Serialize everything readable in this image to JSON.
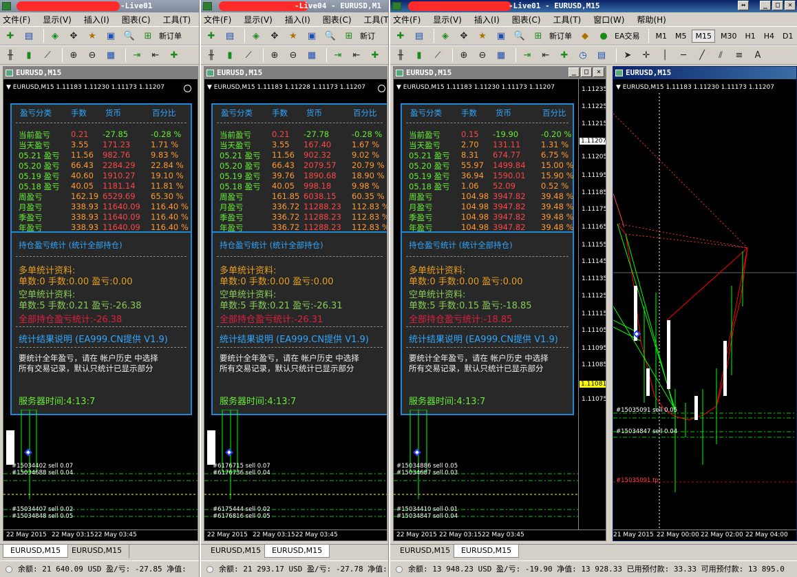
{
  "terminals": [
    {
      "title": "-Live01",
      "menus": [
        "文件(F)",
        "显示(V)",
        "插入(I)",
        "图表(C)",
        "工具(T)"
      ],
      "toolbar_text": "新订单",
      "chart_title": "EURUSD,M15",
      "chart_info": "EURUSD,M15  1.11183 1.11230 1.11173 1.11207",
      "panel": {
        "headers": [
          "盈亏分类",
          "手数",
          "货币",
          "百分比"
        ],
        "rows": [
          [
            "当前盈亏",
            "0.21",
            "-27.85",
            "-0.28 %"
          ],
          [
            "当天盈亏",
            "3.55",
            "171.23",
            "1.71 %"
          ],
          [
            "05.21 盈亏",
            "11.56",
            "982.76",
            "9.83 %"
          ],
          [
            "05.20 盈亏",
            "66.43",
            "2284.29",
            "22.84 %"
          ],
          [
            "05.19 盈亏",
            "40.60",
            "1910.27",
            "19.10 %"
          ],
          [
            "05.18 盈亏",
            "40.05",
            "1181.14",
            "11.81 %"
          ],
          [
            "周盈亏",
            "162.19",
            "6529.69",
            "65.30 %"
          ],
          [
            "月盈亏",
            "338.93",
            "11640.09",
            "116.40 %"
          ],
          [
            "季盈亏",
            "338.93",
            "11640.09",
            "116.40 %"
          ],
          [
            "年盈亏",
            "338.93",
            "11640.09",
            "116.40 %"
          ]
        ],
        "pos_title": "持仓盈亏统计  (统计全部持仓)",
        "long_title": "多单统计资料:",
        "long_line": "单数:0      手数:0.00    盈亏:0.00",
        "short_title": "空单统计资料:",
        "short_line": "单数:5      手数:0.21    盈亏:-26.38",
        "total": "全部持仓盈亏统计:-26.38",
        "note_title": "统计结果说明   (EA999.CN提供 V1.9)",
        "note1": "要统计全年盈亏，请在 帐户历史 中选择",
        "note2": "所有交易记录，默认只统计已显示部分",
        "server": "服务器时间:4:13:7"
      },
      "orders": [
        "#15034402 sell 0.07",
        "#15034688 sell 0.04",
        "#15034407 sell 0.02",
        "#15034848 sell 0.05"
      ],
      "xlabels": [
        "22 May 2015",
        "22 May 03:15",
        "22 May 03:45"
      ],
      "tabs": [
        "EURUSD,M15",
        "EURUSD,M15"
      ],
      "status": "余额: 21 640.09 USD  盈/亏: -27.85  净值:"
    },
    {
      "title": "-Live04 - EURUSD,M1",
      "menus": [
        "文件(F)",
        "显示(V)",
        "插入(I)",
        "图表(C)",
        "工具(T)"
      ],
      "toolbar_text": "新订",
      "chart_title": "EURUSD,M15",
      "chart_info": "EURUSD,M15  1.11183 1.11228 1.11173 1.11207",
      "panel": {
        "headers": [
          "盈亏分类",
          "手数",
          "货币",
          "百分比"
        ],
        "rows": [
          [
            "当前盈亏",
            "0.21",
            "-27.78",
            "-0.28 %"
          ],
          [
            "当天盈亏",
            "3.55",
            "167.40",
            "1.67 %"
          ],
          [
            "05.21 盈亏",
            "11.56",
            "902.32",
            "9.02 %"
          ],
          [
            "05.20 盈亏",
            "66.43",
            "2079.57",
            "20.79 %"
          ],
          [
            "05.19 盈亏",
            "39.76",
            "1890.68",
            "18.90 %"
          ],
          [
            "05.18 盈亏",
            "40.05",
            "998.18",
            "9.98 %"
          ],
          [
            "周盈亏",
            "161.85",
            "6038.15",
            "60.35 %"
          ],
          [
            "月盈亏",
            "336.72",
            "11288.23",
            "112.83 %"
          ],
          [
            "季盈亏",
            "336.72",
            "11288.23",
            "112.83 %"
          ],
          [
            "年盈亏",
            "336.72",
            "11288.23",
            "112.83 %"
          ]
        ],
        "pos_title": "持仓盈亏统计  (统计全部持仓)",
        "long_title": "多单统计资料:",
        "long_line": "单数:0      手数:0.00    盈亏:0.00",
        "short_title": "空单统计资料:",
        "short_line": "单数:5      手数:0.21    盈亏:-26.31",
        "total": "全部持仓盈亏统计:-26.31",
        "note_title": "统计结果说明   (EA999.CN提供 V1.9)",
        "note1": "要统计全年盈亏，请在 帐户历史 中选择",
        "note2": "所有交易记录，默认只统计已显示部分",
        "server": "服务器时间:4:13:7"
      },
      "orders": [
        "#6176715 sell 0.07",
        "#6176736 sell 0.04",
        "#6175444 sell 0.02",
        "#6176816 sell 0.05"
      ],
      "xlabels": [
        "22 May 2015",
        "22 May 03:15",
        "22 May 03:45"
      ],
      "tabs": [
        "EURUSD,M15",
        "EURUSD,M15"
      ],
      "status": "余额: 21 293.17 USD  盈/亏: -27.78  净值:"
    },
    {
      "title": "-Live01 - EURUSD,M15",
      "menus": [
        "文件(F)",
        "显示(V)",
        "插入(I)",
        "图表(C)",
        "工具(T)",
        "窗口(W)",
        "帮助(H)"
      ],
      "toolbar_text": "新订单",
      "ea_text": "EA交易",
      "timeframes": [
        "M1",
        "M5",
        "M15",
        "M30",
        "H1",
        "H4",
        "D1"
      ],
      "chart_title": "EURUSD,M15",
      "chart_info": "EURUSD,M15  1.11183 1.11230 1.11173 1.11207",
      "panel": {
        "headers": [
          "盈亏分类",
          "手数",
          "货币",
          "百分比"
        ],
        "rows": [
          [
            "当前盈亏",
            "0.15",
            "-19.90",
            "-0.20 %"
          ],
          [
            "当天盈亏",
            "2.70",
            "131.11",
            "1.31 %"
          ],
          [
            "05.21 盈亏",
            "8.31",
            "674.77",
            "6.75 %"
          ],
          [
            "05.20 盈亏",
            "55.97",
            "1499.84",
            "15.00 %"
          ],
          [
            "05.19 盈亏",
            "36.94",
            "1590.01",
            "15.90 %"
          ],
          [
            "05.18 盈亏",
            "1.06",
            "52.09",
            "0.52 %"
          ],
          [
            "周盈亏",
            "104.98",
            "3947.82",
            "39.48 %"
          ],
          [
            "月盈亏",
            "104.98",
            "3947.82",
            "39.48 %"
          ],
          [
            "季盈亏",
            "104.98",
            "3947.82",
            "39.48 %"
          ],
          [
            "年盈亏",
            "104.98",
            "3947.82",
            "39.48 %"
          ]
        ],
        "pos_title": "持仓盈亏统计  (统计全部持仓)",
        "long_title": "多单统计资料:",
        "long_line": "单数:0      手数:0.00    盈亏:0.00",
        "short_title": "空单统计资料:",
        "short_line": "单数:5      手数:0.15    盈亏:-18.85",
        "total": "全部持仓盈亏统计:-18.85",
        "note_title": "统计结果说明   (EA999.CN提供 V1.9)",
        "note1": "要统计全年盈亏，请在 帐户历史 中选择",
        "note2": "所有交易记录，默认只统计已显示部分",
        "server": "服务器时间:4:13:7"
      },
      "orders": [
        "#15034886 sell 0.05",
        "#15034687 sell 0.03",
        "#15034410 sell 0.01",
        "#15034847 sell 0.04"
      ],
      "xlabels": [
        "22 May 2015",
        "22 May 03:15",
        "22 May 03:45"
      ],
      "right_chart_title": "EURUSD,M15",
      "right_chart_info": "EURUSD,M15  1.11183 1.11230 1.11173 1.11207",
      "price_scale": [
        "1.11235",
        "1.11225",
        "1.11215",
        "1.11207",
        "1.11205",
        "1.11195",
        "1.11185",
        "1.11175",
        "1.11165",
        "1.11155",
        "1.11145",
        "1.11135",
        "1.11125",
        "1.11115",
        "1.11105",
        "1.11095",
        "1.11085",
        "1.11081",
        "1.11075"
      ],
      "right_orders": [
        "#15035091 sell 0.05",
        "#15034847 sell 0.04",
        "#15035091 tp"
      ],
      "right_xlabels": [
        "21 May 2015",
        "22 May 00:00",
        "22 May 02:00",
        "22 May 04:00"
      ],
      "tabs": [
        "EURUSD,M15",
        "EURUSD,M15"
      ],
      "status": "余额: 13 948.23 USD  盈/亏: -19.90  净值: 13 928.33  已用预付款: 33.33  可用预付款: 13 895.0"
    }
  ]
}
